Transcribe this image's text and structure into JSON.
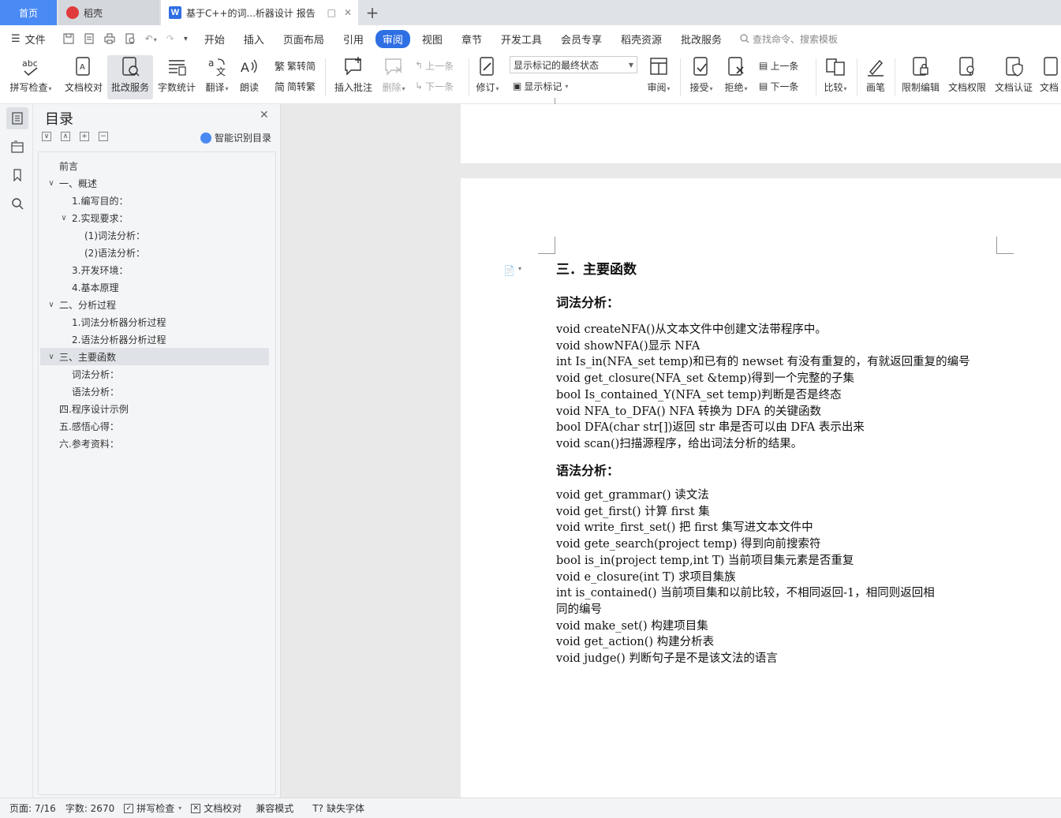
{
  "tabs": {
    "home": "首页",
    "daoke": "稻壳",
    "doc_title": "基于C++的词...析器设计 报告",
    "add": "+"
  },
  "menu": {
    "file": "文件",
    "items": [
      "开始",
      "插入",
      "页面布局",
      "引用",
      "审阅",
      "视图",
      "章节",
      "开发工具",
      "会员专享",
      "稻壳资源",
      "批改服务"
    ],
    "active_index": 4,
    "search_placeholder": "查找命令、搜索模板"
  },
  "ribbon": {
    "spell_check": "拼写检查",
    "doc_proof": "文档校对",
    "correct_service": "批改服务",
    "word_count": "字数统计",
    "translate": "翻译",
    "read_aloud": "朗读",
    "to_traditional": "繁转简",
    "to_simplified": "简转繁",
    "insert_comment": "插入批注",
    "delete": "删除",
    "prev": "上一条",
    "next": "下一条",
    "revise": "修订",
    "markup_state": "显示标记的最终状态",
    "show_markup": "显示标记",
    "review": "审阅",
    "accept": "接受",
    "reject": "拒绝",
    "prev2": "上一条",
    "next2": "下一条",
    "compare": "比较",
    "pen": "画笔",
    "restrict_edit": "限制编辑",
    "doc_permission": "文档权限",
    "doc_cert": "文档认证",
    "doc_more": "文档"
  },
  "toc": {
    "title": "目录",
    "smart_label": "智能识别目录",
    "items": [
      {
        "text": "前言",
        "level": 0,
        "chevron": ""
      },
      {
        "text": "一、概述",
        "level": 0,
        "chevron": "v"
      },
      {
        "text": "1.编写目的：",
        "level": 1,
        "chevron": ""
      },
      {
        "text": "2.实现要求：",
        "level": 1,
        "chevron": "v"
      },
      {
        "text": "(1)词法分析：",
        "level": 2,
        "chevron": ""
      },
      {
        "text": "(2)语法分析：",
        "level": 2,
        "chevron": ""
      },
      {
        "text": "3.开发环境：",
        "level": 1,
        "chevron": ""
      },
      {
        "text": "4.基本原理",
        "level": 1,
        "chevron": ""
      },
      {
        "text": "二、分析过程",
        "level": 0,
        "chevron": "v"
      },
      {
        "text": "1.词法分析器分析过程",
        "level": 1,
        "chevron": ""
      },
      {
        "text": "2.语法分析器分析过程",
        "level": 1,
        "chevron": ""
      },
      {
        "text": "三、主要函数",
        "level": 0,
        "chevron": "v",
        "selected": true
      },
      {
        "text": "词法分析：",
        "level": 1,
        "chevron": ""
      },
      {
        "text": "语法分析：",
        "level": 1,
        "chevron": ""
      },
      {
        "text": "四.程序设计示例",
        "level": 0,
        "chevron": ""
      },
      {
        "text": "五.感悟心得：",
        "level": 0,
        "chevron": ""
      },
      {
        "text": "六.参考资料：",
        "level": 0,
        "chevron": ""
      }
    ]
  },
  "document": {
    "heading": "三．主要函数",
    "lex_heading": "词法分析：",
    "lex_lines": [
      "void createNFA()从文本文件中创建文法带程序中。",
      "void showNFA()显示 NFA",
      "int Is_in(NFA_set temp)和已有的 newset 有没有重复的，有就返回重复的编号",
      "void get_closure(NFA_set &temp)得到一个完整的子集",
      "bool Is_contained_Y(NFA_set temp)判断是否是终态",
      "void NFA_to_DFA() NFA 转换为 DFA 的关键函数",
      "bool DFA(char str[])返回 str 串是否可以由 DFA 表示出来",
      "void scan()扫描源程序，给出词法分析的结果。"
    ],
    "syn_heading": "语法分析：",
    "syn_lines": [
      "void get_grammar()  读文法",
      "void get_first()  计算 first 集",
      "void write_first_set() 把 first 集写进文本文件中",
      "void gete_search(project temp)   得到向前搜索符",
      "bool is_in(project temp,int T)   当前项目集元素是否重复",
      "void e_closure(int T)   求项目集族",
      "int is_contained()   当前项目集和以前比较，不相同返回-1，相同则返回相",
      "同的编号",
      "void make_set() 构建项目集",
      "void get_action() 构建分析表",
      "void judge() 判断句子是不是该文法的语言"
    ]
  },
  "status": {
    "page": "页面: 7/16",
    "words": "字数: 2670",
    "spell": "拼写检查",
    "proof": "文档校对",
    "compat": "兼容模式",
    "missing_font": "缺失字体"
  },
  "colors": {
    "accent": "#2f6fe4",
    "home_tab": "#4a8af4",
    "squiggle": "#dd3333"
  }
}
